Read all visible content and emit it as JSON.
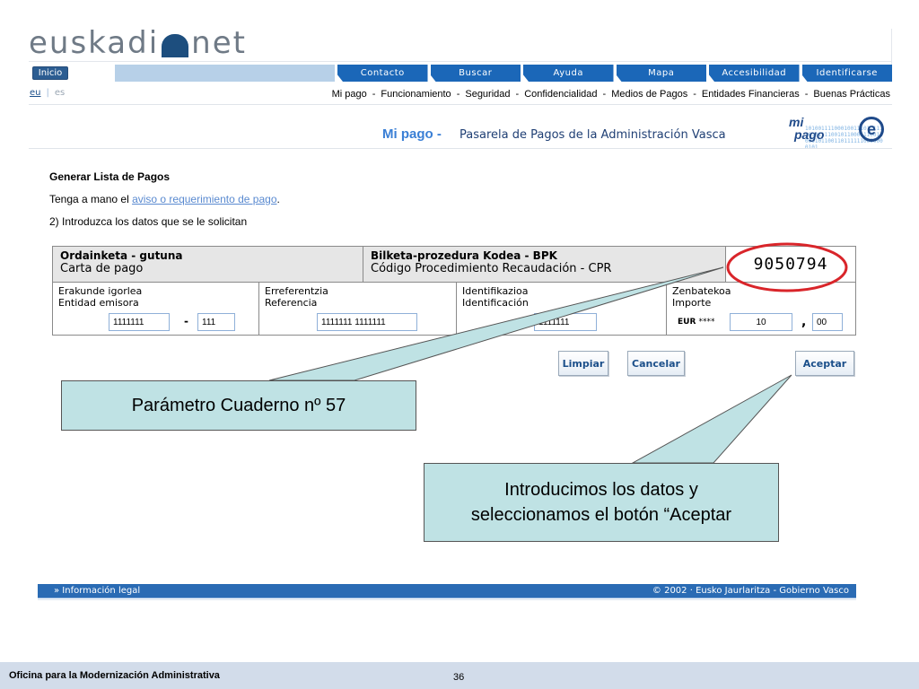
{
  "header": {
    "logo_left": "euskadi",
    "logo_right": "net"
  },
  "nav": {
    "home": "Inicio",
    "tabs": [
      "Contacto",
      "Buscar",
      "Ayuda",
      "Mapa",
      "Accesibilidad",
      "Identificarse"
    ]
  },
  "lang": {
    "eu": "eu",
    "sep": "|",
    "es": "es"
  },
  "subnav": {
    "items": [
      "Mi pago",
      "Funcionamiento",
      "Seguridad",
      "Confidencialidad",
      "Medios de Pagos",
      "Entidades Financieras",
      "Buenas Prácticas"
    ],
    "separator": "-"
  },
  "banner": {
    "title": "Mi pago -",
    "subtitle": "Pasarela de Pagos de la Administración Vasca",
    "logo_mi": "mi",
    "logo_pago": "pago",
    "logo_bits": "1010011110001001110111111010111100101100011100110001011001101111110000000101",
    "logo_e": "e"
  },
  "content": {
    "heading": "Generar Lista de Pagos",
    "line1_prefix": "Tenga a mano el ",
    "line1_link": "aviso o requerimiento de pago",
    "line1_suffix": ".",
    "line2": "2) Introduzca los datos que se le solicitan"
  },
  "form": {
    "carta_eu": "Ordainketa - gutuna",
    "carta_es": "Carta de pago",
    "cpr_eu": "Bilketa-prozedura Kodea - BPK",
    "cpr_es": "Código Procedimiento Recaudación - CPR",
    "cpr_code": "9050794",
    "entidad_eu": "Erakunde igorlea",
    "entidad_es": "Entidad emisora",
    "entidad_value1": "1111111",
    "entidad_dash": "-",
    "entidad_value2": "111",
    "ref_eu": "Erreferentzia",
    "ref_es": "Referencia",
    "ref_value": "1111111 1111111",
    "ident_eu": "Identifikazioa",
    "ident_es": "Identificación",
    "ident_value": "1111111",
    "importe_eu": "Zenbatekoa",
    "importe_es": "Importe",
    "currency": "EUR",
    "stars": "****",
    "importe_int": "10",
    "importe_comma": ",",
    "importe_dec": "00"
  },
  "buttons": {
    "limpiar": "Limpiar",
    "cancelar": "Cancelar",
    "aceptar": "Aceptar"
  },
  "callouts": {
    "param": "Parámetro Cuaderno nº 57",
    "intro_line1": "Introducimos los datos y",
    "intro_line2": "seleccionamos el botón “Aceptar"
  },
  "legal": {
    "left": "» Información legal",
    "right": "© 2002 · Eusko Jaurlaritza - Gobierno Vasco"
  },
  "slide_footer": {
    "org": "Oficina para la Modernización Administrativa",
    "page": "36"
  },
  "colors": {
    "nav_tab": "#1b67b8",
    "callout_bg": "#bfe2e4",
    "highlight_circle": "#d9252a",
    "slide_footer_bg": "#d2dcea"
  }
}
